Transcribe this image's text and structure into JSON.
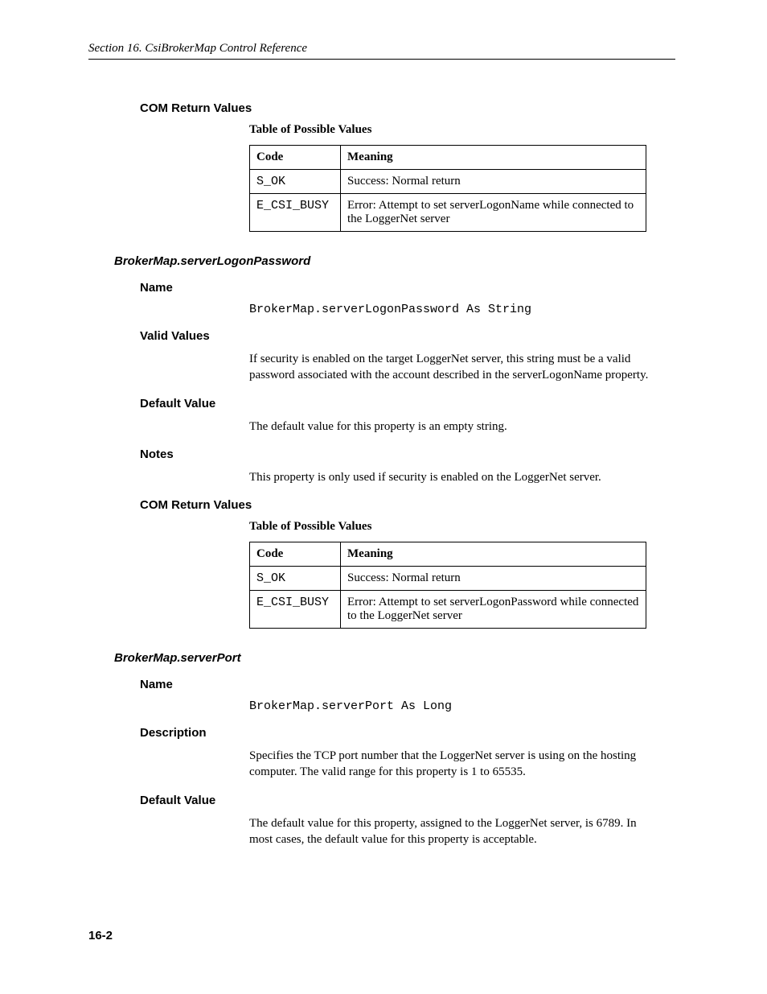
{
  "header": {
    "running": "Section 16.  CsiBrokerMap Control Reference"
  },
  "sections": [
    {
      "lvl1_heading": "COM Return Values",
      "table_caption": "Table of Possible Values",
      "table": {
        "head": {
          "code": "Code",
          "meaning": "Meaning"
        },
        "rows": [
          {
            "code": "S_OK",
            "meaning": "Success: Normal return"
          },
          {
            "code": "E_CSI_BUSY",
            "meaning": "Error: Attempt to set serverLogonName while connected to the LoggerNet server"
          }
        ]
      }
    }
  ],
  "property1": {
    "title": "BrokerMap.serverLogonPassword",
    "name_heading": "Name",
    "name_sig": "BrokerMap.serverLogonPassword As String",
    "valid_heading": "Valid Values",
    "valid_text": "If security is enabled on the target LoggerNet server, this string must be a valid password associated with the account described in the serverLogonName property.",
    "default_heading": "Default Value",
    "default_text": "The default value for this property is an empty string.",
    "notes_heading": "Notes",
    "notes_text": "This property is only used if security is enabled on the LoggerNet server.",
    "com_heading": "COM Return Values",
    "table_caption": "Table of Possible Values",
    "table": {
      "head": {
        "code": "Code",
        "meaning": "Meaning"
      },
      "rows": [
        {
          "code": "S_OK",
          "meaning": "Success: Normal return"
        },
        {
          "code": "E_CSI_BUSY",
          "meaning": "Error: Attempt to set serverLogonPassword while connected to the LoggerNet server"
        }
      ]
    }
  },
  "property2": {
    "title": "BrokerMap.serverPort",
    "name_heading": "Name",
    "name_sig": "BrokerMap.serverPort As Long",
    "desc_heading": "Description",
    "desc_text": "Specifies the TCP port number that the LoggerNet server is using on the hosting computer.  The valid range for this property is 1 to 65535.",
    "default_heading": "Default Value",
    "default_text": "The default value for this property, assigned to the LoggerNet server, is 6789.  In most cases, the default value for this property is acceptable."
  },
  "footer": {
    "page_number": "16-2"
  }
}
